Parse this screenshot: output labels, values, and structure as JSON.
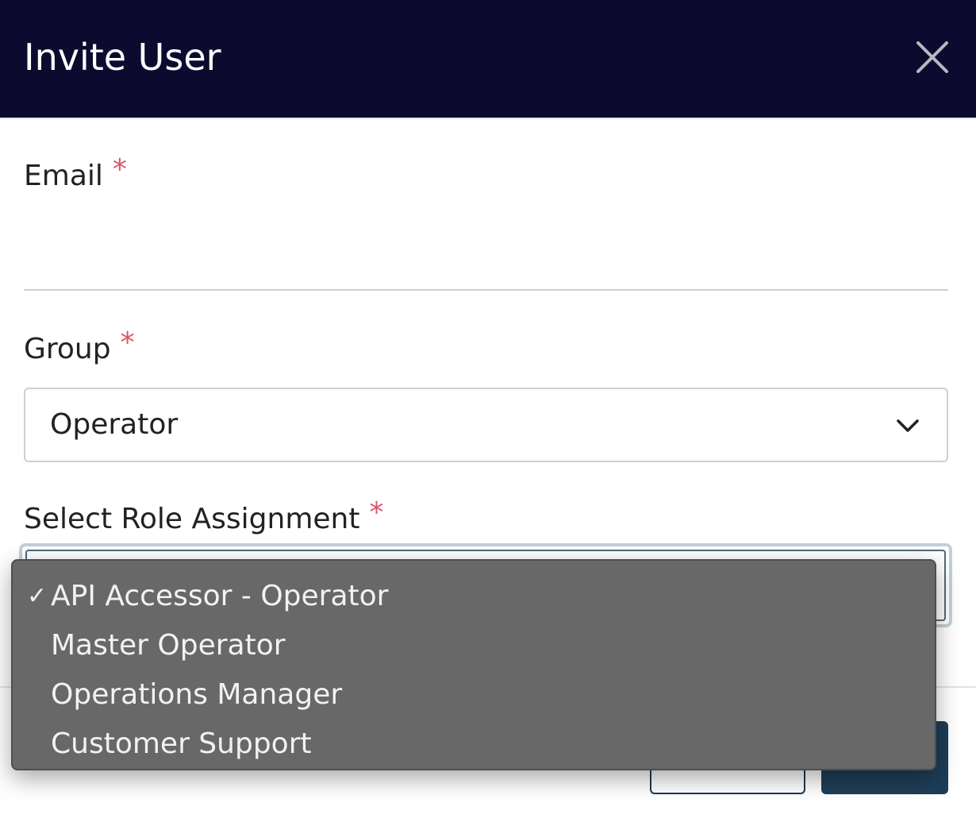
{
  "dialog": {
    "title": "Invite User",
    "close_icon": "close-icon"
  },
  "form": {
    "email": {
      "label": "Email",
      "required_mark": "*",
      "value": "",
      "placeholder": ""
    },
    "group": {
      "label": "Group",
      "required_mark": "*",
      "selected": "Operator",
      "icon": "chevron-down-icon"
    },
    "role": {
      "label": "Select Role Assignment",
      "required_mark": "*",
      "options": [
        {
          "label": "API Accessor - Operator",
          "selected": true
        },
        {
          "label": "Master Operator",
          "selected": false
        },
        {
          "label": "Operations Manager",
          "selected": false
        },
        {
          "label": "Customer Support",
          "selected": false
        }
      ],
      "check_mark": "✓"
    }
  },
  "colors": {
    "header_bg": "#0c0b2f",
    "required": "#d9576b",
    "primary_button": "#1e3e58",
    "dropdown_bg": "#686868"
  }
}
